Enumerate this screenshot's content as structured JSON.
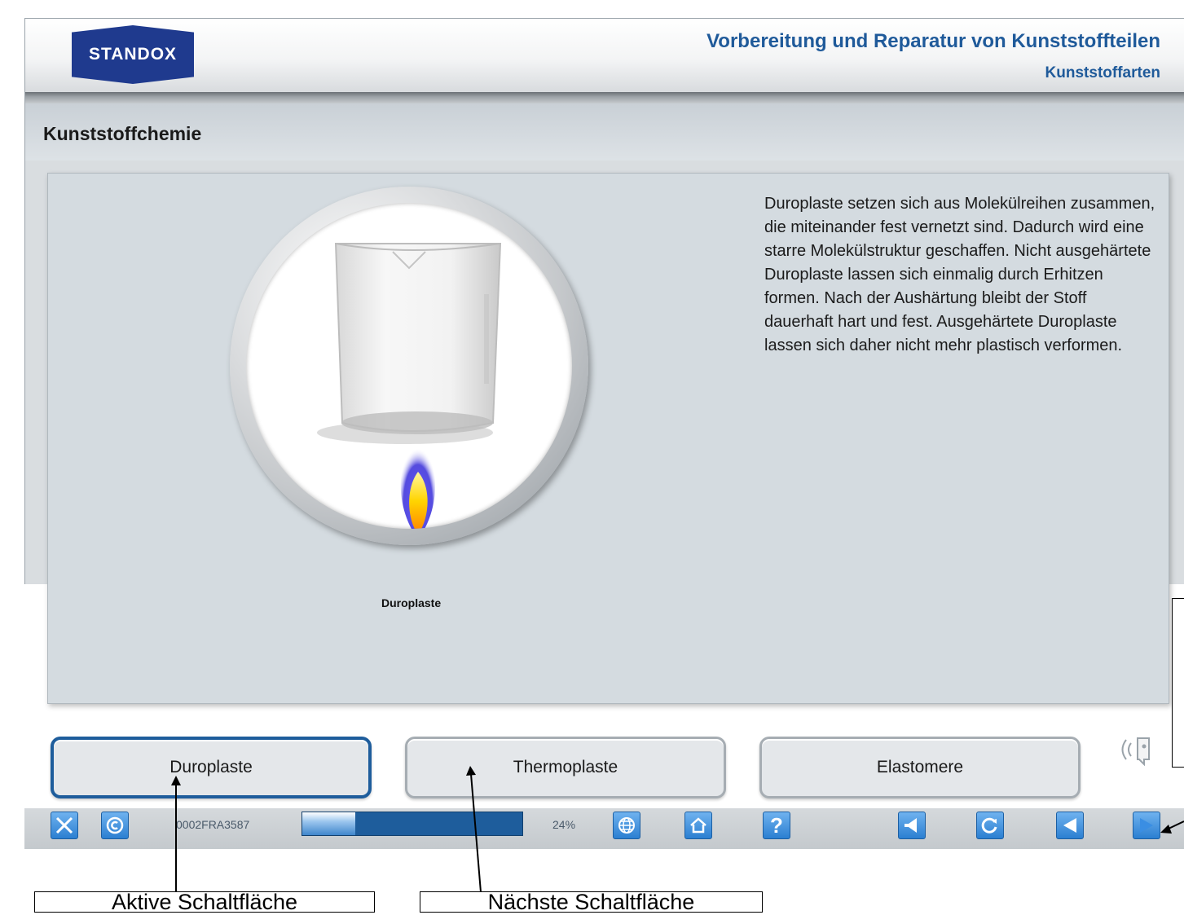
{
  "header": {
    "logo_text": "STANDOX",
    "title": "Vorbereitung und Reparatur von Kunststoffteilen",
    "subtitle": "Kunststoffarten"
  },
  "section": {
    "title": "Kunststoffchemie"
  },
  "illustration": {
    "caption": "Duroplaste"
  },
  "description": "Duroplaste setzen sich aus Molekülreihen zusammen, die miteinander fest vernetzt sind. Dadurch wird eine starre Molekülstruktur geschaffen. Nicht ausgehärtete Duroplaste lassen sich einmalig durch Erhitzen formen. Nach der Aushärtung bleibt der Stoff dauerhaft hart und fest. Ausgehärtete Duroplaste lassen sich daher nicht mehr plastisch verformen.",
  "tabs": [
    {
      "label": "Duroplaste",
      "active": true
    },
    {
      "label": "Thermoplaste",
      "active": false
    },
    {
      "label": "Elastomere",
      "active": false
    }
  ],
  "footer": {
    "page_id": "0002FRA3587",
    "progress_percent": 24,
    "progress_label": "24%",
    "icons": [
      "close-icon",
      "copyright-icon",
      "globe-icon",
      "home-icon",
      "help-icon",
      "audio-icon",
      "reload-icon",
      "back-icon",
      "next-icon"
    ]
  },
  "callouts": {
    "active": "Aktive Schaltfläche",
    "next": "Nächste Schaltfläche"
  },
  "colors": {
    "brand": "#1f3a8e",
    "title": "#1f5a9a",
    "active_border": "#1e5d9c",
    "button_blue": "#2b7fd1"
  }
}
